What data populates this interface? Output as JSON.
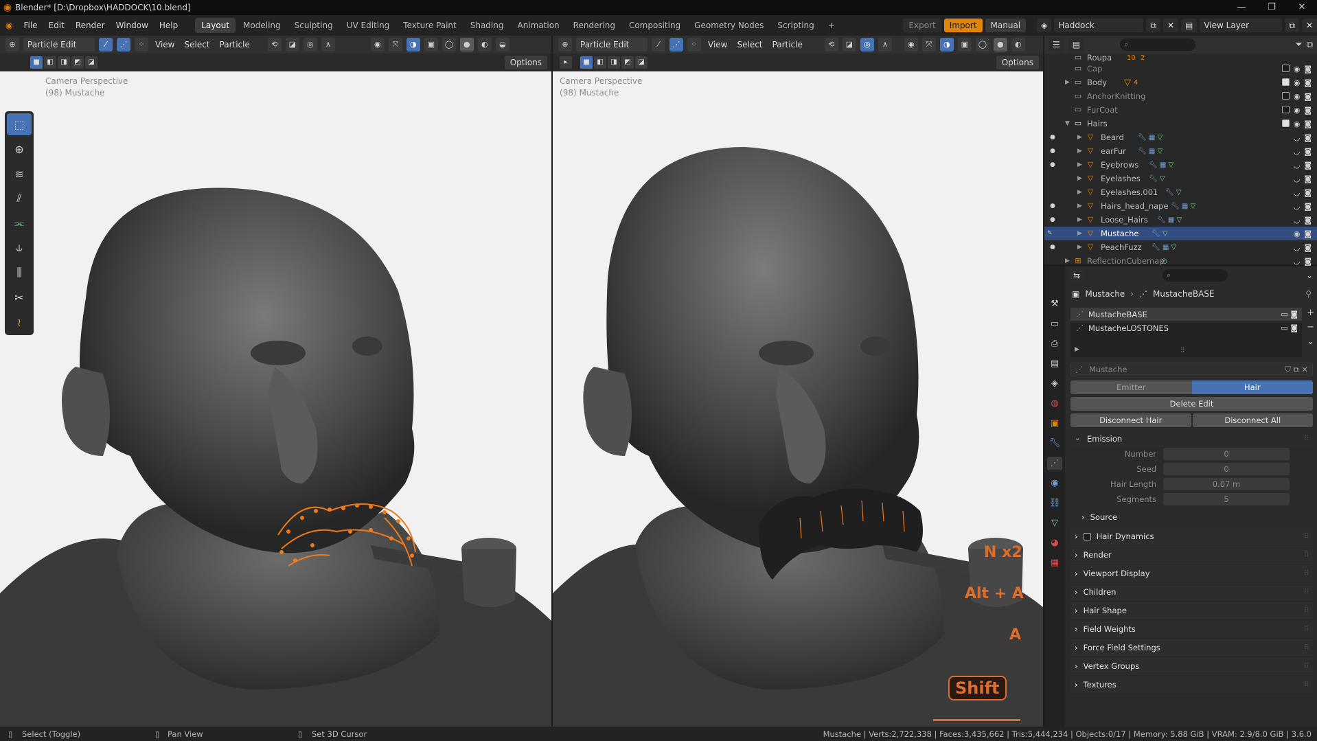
{
  "titlebar": {
    "title": "Blender* [D:\\Dropbox\\HADDOCK\\10.blend]"
  },
  "menus": [
    "File",
    "Edit",
    "Render",
    "Window",
    "Help"
  ],
  "workspaces": [
    {
      "label": "Layout",
      "active": true
    },
    {
      "label": "Modeling"
    },
    {
      "label": "Sculpting"
    },
    {
      "label": "UV Editing"
    },
    {
      "label": "Texture Paint"
    },
    {
      "label": "Shading"
    },
    {
      "label": "Animation"
    },
    {
      "label": "Rendering"
    },
    {
      "label": "Compositing"
    },
    {
      "label": "Geometry Nodes"
    },
    {
      "label": "Scripting"
    }
  ],
  "top_right": {
    "export": "Export",
    "import": "Import",
    "manual": "Manual",
    "scene": "Haddock",
    "view_layer": "View Layer"
  },
  "viewport_header": {
    "mode": "Particle Edit",
    "menus": [
      "View",
      "Select",
      "Particle"
    ],
    "options": "Options"
  },
  "viewport_overlay": {
    "line1": "Camera Perspective",
    "line2": "(98) Mustache"
  },
  "keys": {
    "k1": "N x2",
    "k2": "Alt + A",
    "k3": "A",
    "k4": "Shift"
  },
  "outliner": {
    "rows": [
      {
        "label": "Roupa",
        "indent": 1
      },
      {
        "label": "Cap",
        "indent": 1
      },
      {
        "label": "Body",
        "indent": 1
      },
      {
        "label": "AnchorKnitting",
        "indent": 1
      },
      {
        "label": "FurCoat",
        "indent": 1
      },
      {
        "label": "Hairs",
        "indent": 1
      },
      {
        "label": "Beard",
        "indent": 2
      },
      {
        "label": "earFur",
        "indent": 2
      },
      {
        "label": "Eyebrows",
        "indent": 2
      },
      {
        "label": "Eyelashes",
        "indent": 2
      },
      {
        "label": "Eyelashes.001",
        "indent": 2
      },
      {
        "label": "Hairs_head_nape",
        "indent": 2
      },
      {
        "label": "Loose_Hairs",
        "indent": 2
      },
      {
        "label": "Mustache",
        "indent": 2,
        "selected": true
      },
      {
        "label": "PeachFuzz",
        "indent": 2
      },
      {
        "label": "ReflectionCubemap",
        "indent": 1
      }
    ],
    "body_badge": "4",
    "roupa_badge": "10",
    "roupa_badge2": "2"
  },
  "properties": {
    "breadcrumb_object": "Mustache",
    "breadcrumb_psys": "MustacheBASE",
    "psys_list": [
      "MustacheBASE",
      "MustacheLOSTONES"
    ],
    "settings_name": "Mustache",
    "type_tabs": [
      "Emitter",
      "Hair"
    ],
    "delete_edit": "Delete Edit",
    "disconnect_hair": "Disconnect Hair",
    "disconnect_all": "Disconnect All",
    "emission": {
      "title": "Emission",
      "fields": [
        {
          "label": "Number",
          "value": "0"
        },
        {
          "label": "Seed",
          "value": "0"
        },
        {
          "label": "Hair Length",
          "value": "0.07 m"
        },
        {
          "label": "Segments",
          "value": "5"
        }
      ],
      "source": "Source"
    },
    "panels": [
      "Hair Dynamics",
      "Render",
      "Viewport Display",
      "Children",
      "Hair Shape",
      "Field Weights",
      "Force Field Settings",
      "Vertex Groups",
      "Textures"
    ]
  },
  "statusbar": {
    "select": "Select (Toggle)",
    "pan": "Pan View",
    "cursor": "Set 3D Cursor",
    "stats": "Mustache | Verts:2,722,338 | Faces:3,435,662 | Tris:5,444,234 | Objects:0/17 | Memory: 5.88 GiB | VRAM: 2.9/8.0 GiB | 3.6.0"
  }
}
